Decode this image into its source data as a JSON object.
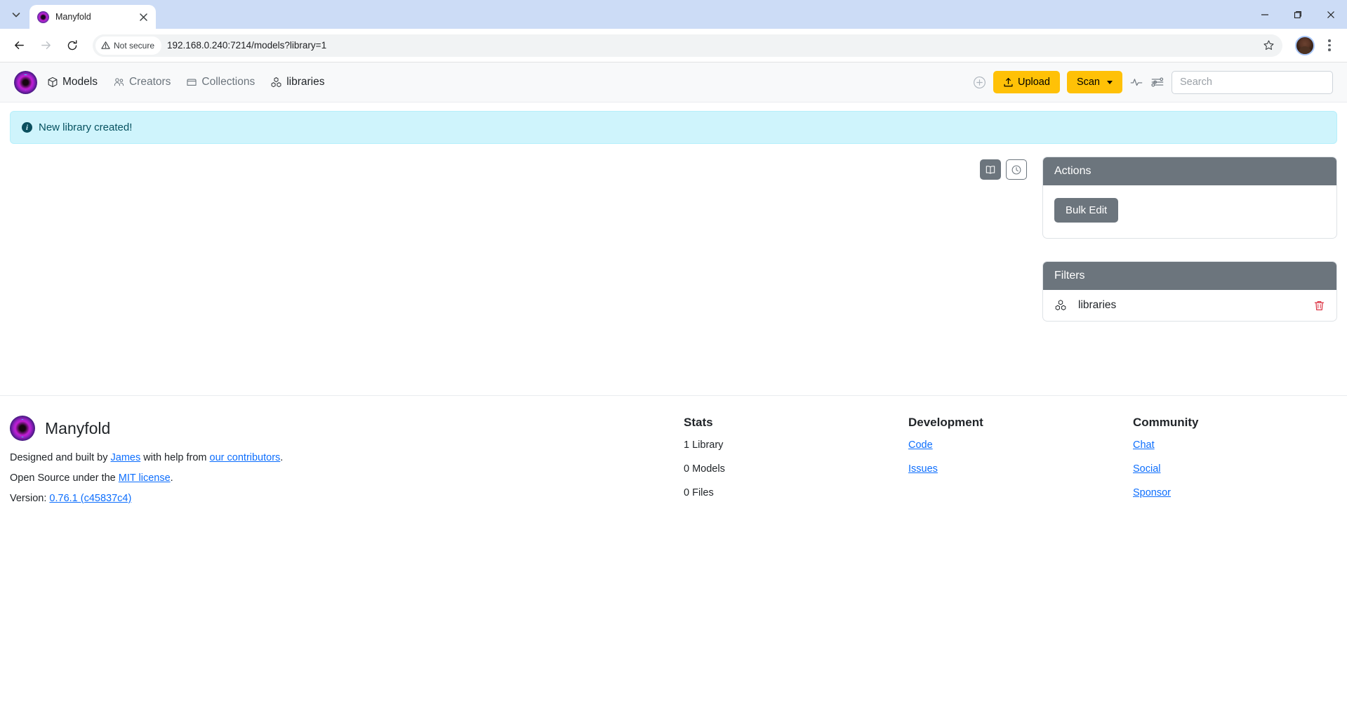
{
  "browser": {
    "tab": {
      "title": "Manyfold",
      "favicon": "manyfold-logo-icon"
    },
    "tab_search_label": "Search tabs",
    "security_label": "Not secure",
    "url": "192.168.0.240:7214/models?library=1",
    "window": {
      "minimize": "Minimize",
      "maximize": "Maximize",
      "close": "Close"
    },
    "bookmark_label": "Bookmark this tab",
    "profile_label": "Profile",
    "menu_label": "Customize and control Google Chrome"
  },
  "app": {
    "brand": "Manyfold",
    "nav": [
      {
        "label": "Models",
        "icon": "cube-icon",
        "active": true
      },
      {
        "label": "Creators",
        "icon": "users-icon",
        "active": false
      },
      {
        "label": "Collections",
        "icon": "collection-box-icon",
        "active": false
      },
      {
        "label": "libraries",
        "icon": "library-group-icon",
        "active": true
      }
    ],
    "toolbar": {
      "add_label": "Add",
      "upload_label": "Upload",
      "scan_label": "Scan",
      "activity_label": "Activity",
      "settings_label": "Settings"
    },
    "search": {
      "placeholder": "Search",
      "value": ""
    }
  },
  "alert": {
    "icon": "info-icon",
    "message": "New library created!"
  },
  "view_toggles": [
    {
      "name": "library-view",
      "icon": "book-icon",
      "active": true
    },
    {
      "name": "recent-view",
      "icon": "clock-icon",
      "active": false
    }
  ],
  "actions_card": {
    "title": "Actions",
    "bulk_edit_label": "Bulk Edit"
  },
  "filters_card": {
    "title": "Filters",
    "rows": [
      {
        "icon": "library-group-icon",
        "label": "libraries",
        "delete_label": "Remove filter"
      }
    ]
  },
  "footer": {
    "brand": "Manyfold",
    "credit_prefix": "Designed and built by ",
    "credit_author": "James",
    "credit_middle": " with help from ",
    "credit_contributors": "our contributors",
    "credit_suffix": ".",
    "license_prefix": "Open Source under the ",
    "license_link": "MIT license",
    "license_suffix": ".",
    "version_prefix": "Version: ",
    "version_link": "0.76.1 (c45837c4)",
    "stats": {
      "title": "Stats",
      "items": [
        "1 Library",
        "0 Models",
        "0 Files"
      ]
    },
    "development": {
      "title": "Development",
      "links": [
        "Code",
        "Issues"
      ]
    },
    "community": {
      "title": "Community",
      "links": [
        "Chat",
        "Social",
        "Sponsor"
      ]
    }
  },
  "colors": {
    "accent_warning": "#ffc107",
    "secondary": "#6c757d",
    "info_bg": "#cff4fc",
    "info_text": "#055160",
    "danger": "#dc3545",
    "link": "#0d6efd"
  }
}
